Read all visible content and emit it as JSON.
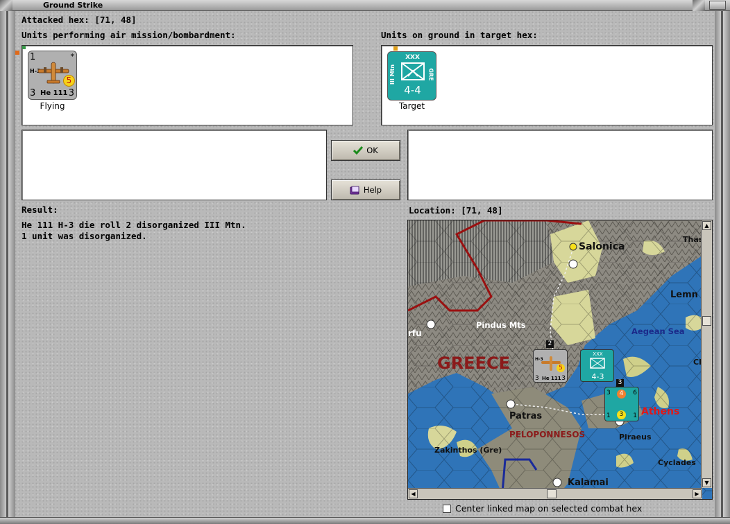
{
  "window": {
    "title": "Ground Strike"
  },
  "attacked_hex": {
    "label": "Attacked hex:",
    "coords": "[71, 48]"
  },
  "air_units": {
    "header": "Units performing air mission/bombardment:",
    "units": [
      {
        "top_left": "1",
        "top_right": "*",
        "model": "H-3",
        "badge": "5",
        "left_value": "3",
        "name": "He 111",
        "right_value": "3",
        "caption": "Flying",
        "color": "#a8a8a8"
      }
    ]
  },
  "ground_units": {
    "header": "Units on ground in target hex:",
    "units": [
      {
        "size": "XXX",
        "side_left": "III Mtn",
        "side_right": "GRE",
        "strength": "4-4",
        "caption": "Target",
        "color": "#1fa7a3"
      }
    ]
  },
  "buttons": {
    "ok": "OK",
    "help": "Help"
  },
  "result": {
    "header": "Result:",
    "lines": [
      "He 111 H-3 die roll 2 disorganized III Mtn.",
      "1 unit was disorganized."
    ]
  },
  "location": {
    "label": "Location:",
    "coords": "[71, 48]"
  },
  "map": {
    "labels": {
      "salonica": "Salonica",
      "thas": "Thas",
      "lemn": "Lemn",
      "pindus": "Pindus Mts",
      "aegean": "Aegean Sea",
      "rfu": "rfu",
      "greece": "GREECE",
      "patras": "Patras",
      "peloponnesos": "PELOPONNESOS",
      "athens": "Athens",
      "piraeus": "Piraeus",
      "zakinthos": "Zakinthos (Gre)",
      "cyclades": "Cyclades",
      "kalamai": "Kalamai",
      "ci": "Cl"
    },
    "map_units": {
      "air": {
        "model": "H-3",
        "badge": "5",
        "left_value": "3",
        "name": "He 111",
        "right_value": "3",
        "stack": "2"
      },
      "ground": {
        "size": "XXX",
        "strength": "4-3"
      },
      "stack": {
        "count": "3",
        "top_badge": "4",
        "top_left": "3",
        "top_right": "6",
        "bottom_badge": "3",
        "bottom_left": "1",
        "bottom_right": "1"
      }
    }
  },
  "options": {
    "center_map_label": "Center linked map on selected combat hex",
    "center_map_checked": false
  },
  "colors": {
    "land": "#8e8b7a",
    "sea": "#2a6fb5",
    "clear": "#d7d79a",
    "greece_label": "#8b1a1a",
    "athens": "#e01818",
    "aegean": "#1b2a8a"
  }
}
